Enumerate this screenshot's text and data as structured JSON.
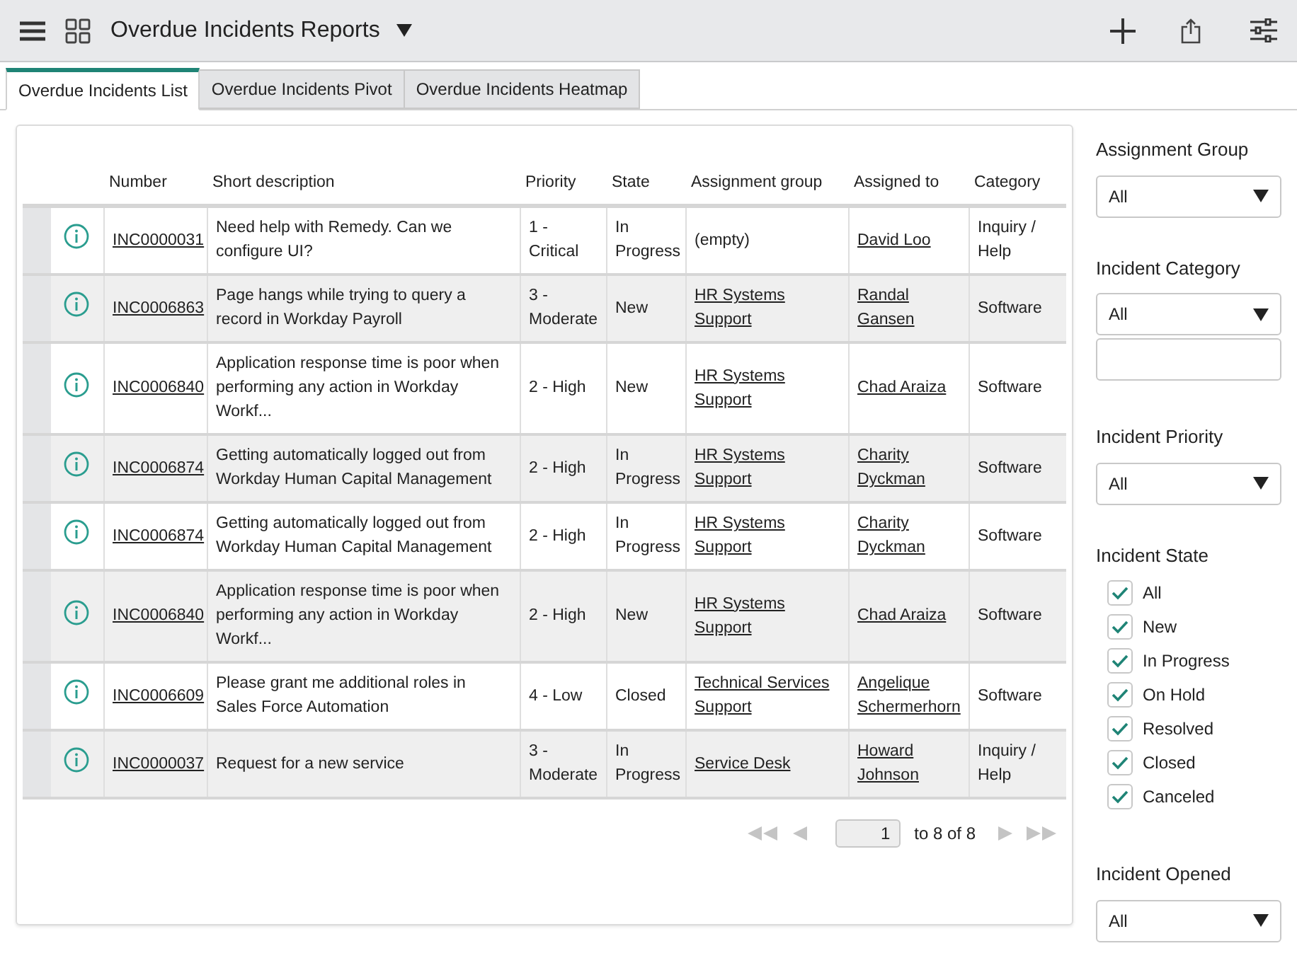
{
  "header": {
    "title": "Overdue Incidents Reports"
  },
  "tabs": [
    {
      "label": "Overdue Incidents List",
      "selected": true
    },
    {
      "label": "Overdue Incidents Pivot",
      "selected": false
    },
    {
      "label": "Overdue Incidents Heatmap",
      "selected": false
    }
  ],
  "table": {
    "columns": [
      "Number",
      "Short description",
      "Priority",
      "State",
      "Assignment group",
      "Assigned to",
      "Category"
    ],
    "rows": [
      {
        "number": "INC0000031",
        "description": "Need help with Remedy. Can we configure UI?",
        "priority": "1 - Critical",
        "state": "In Progress",
        "group": "(empty)",
        "group_link": false,
        "assigned_to": "David Loo",
        "category": "Inquiry / Help"
      },
      {
        "number": "INC0006863",
        "description": "Page hangs while trying to query a record in Workday Payroll",
        "priority": "3 - Moderate",
        "state": "New",
        "group": "HR Systems Support",
        "group_link": true,
        "assigned_to": "Randal Gansen",
        "category": "Software"
      },
      {
        "number": "INC0006840",
        "description": "Application response time is poor when performing any action in Workday Workf...",
        "priority": "2 - High",
        "state": "New",
        "group": "HR Systems Support",
        "group_link": true,
        "assigned_to": "Chad Araiza",
        "category": "Software"
      },
      {
        "number": "INC0006874",
        "description": "Getting automatically logged out from Workday Human Capital Management",
        "priority": "2 - High",
        "state": "In Progress",
        "group": "HR Systems Support",
        "group_link": true,
        "assigned_to": "Charity Dyckman",
        "category": "Software"
      },
      {
        "number": "INC0006874",
        "description": "Getting automatically logged out from Workday Human Capital Management",
        "priority": "2 - High",
        "state": "In Progress",
        "group": "HR Systems Support",
        "group_link": true,
        "assigned_to": "Charity Dyckman",
        "category": "Software"
      },
      {
        "number": "INC0006840",
        "description": "Application response time is poor when performing any action in Workday Workf...",
        "priority": "2 - High",
        "state": "New",
        "group": "HR Systems Support",
        "group_link": true,
        "assigned_to": "Chad Araiza",
        "category": "Software"
      },
      {
        "number": "INC0006609",
        "description": "Please grant me additional roles in Sales Force Automation",
        "priority": "4 - Low",
        "state": "Closed",
        "group": "Technical Services Support",
        "group_link": true,
        "assigned_to": "Angelique Schermerhorn",
        "category": "Software"
      },
      {
        "number": "INC0000037",
        "description": "Request for a new service",
        "priority": "3 - Moderate",
        "state": "In Progress",
        "group": "Service Desk",
        "group_link": true,
        "assigned_to": "Howard Johnson",
        "category": "Inquiry / Help"
      }
    ]
  },
  "pagination": {
    "page": "1",
    "range": "to 8 of 8"
  },
  "filters": [
    {
      "kind": "select",
      "label": "Assignment Group",
      "value": "All"
    },
    {
      "kind": "select_with_field",
      "label": "Incident Category",
      "value": "All"
    },
    {
      "kind": "select",
      "label": "Incident Priority",
      "value": "All"
    },
    {
      "kind": "checkboxes",
      "label": "Incident State",
      "options": [
        {
          "label": "All",
          "checked": true
        },
        {
          "label": "New",
          "checked": true
        },
        {
          "label": "In Progress",
          "checked": true
        },
        {
          "label": "On Hold",
          "checked": true
        },
        {
          "label": "Resolved",
          "checked": true
        },
        {
          "label": "Closed",
          "checked": true
        },
        {
          "label": "Canceled",
          "checked": true
        }
      ]
    },
    {
      "kind": "select",
      "label": "Incident Opened",
      "value": "All"
    }
  ]
}
